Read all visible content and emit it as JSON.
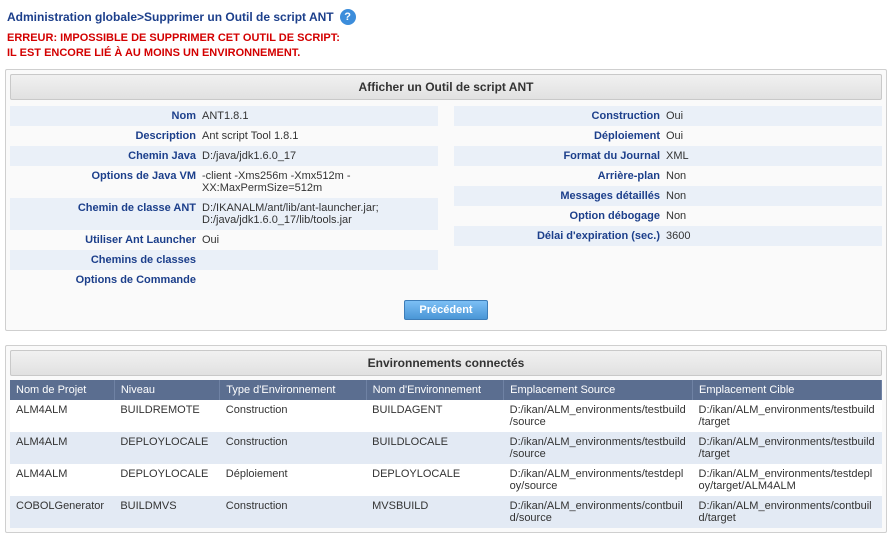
{
  "breadcrumb": {
    "root": "Administration globale",
    "sep": ">",
    "page": "Supprimer un Outil de script ANT"
  },
  "error": {
    "line1": "ERREUR: IMPOSSIBLE DE SUPPRIMER CET OUTIL DE SCRIPT:",
    "line2": "IL EST ENCORE LIÉ À AU MOINS UN ENVIRONNEMENT."
  },
  "panel1": {
    "title": "Afficher un Outil de script ANT",
    "left": [
      {
        "label": "Nom",
        "value": "ANT1.8.1"
      },
      {
        "label": "Description",
        "value": "Ant script Tool 1.8.1"
      },
      {
        "label": "Chemin Java",
        "value": "D:/java/jdk1.6.0_17"
      },
      {
        "label": "Options de Java VM",
        "value": "-client -Xms256m -Xmx512m -XX:MaxPermSize=512m"
      },
      {
        "label": "Chemin de classe ANT",
        "value": "D:/IKANALM/ant/lib/ant-launcher.jar;\nD:/java/jdk1.6.0_17/lib/tools.jar"
      },
      {
        "label": "Utiliser Ant Launcher",
        "value": "Oui"
      },
      {
        "label": "Chemins de classes",
        "value": ""
      },
      {
        "label": "Options de Commande",
        "value": ""
      }
    ],
    "right": [
      {
        "label": "Construction",
        "value": "Oui"
      },
      {
        "label": "Déploiement",
        "value": "Oui"
      },
      {
        "label": "Format du Journal",
        "value": "XML"
      },
      {
        "label": "Arrière-plan",
        "value": "Non"
      },
      {
        "label": "Messages détaillés",
        "value": "Non"
      },
      {
        "label": "Option débogage",
        "value": "Non"
      },
      {
        "label": "Délai d'expiration (sec.)",
        "value": "3600"
      }
    ],
    "back_btn": "Précédent"
  },
  "panel2": {
    "title": "Environnements connectés",
    "columns": [
      "Nom de Projet",
      "Niveau",
      "Type d'Environnement",
      "Nom d'Environnement",
      "Emplacement Source",
      "Emplacement Cible"
    ],
    "rows": [
      {
        "proj": "ALM4ALM",
        "niv": "BUILDREMOTE",
        "type": "Construction",
        "env": "BUILDAGENT",
        "src": "D:/ikan/ALM_environments/testbuild/source",
        "tgt": "D:/ikan/ALM_environments/testbuild/target"
      },
      {
        "proj": "ALM4ALM",
        "niv": "DEPLOYLOCALE",
        "type": "Construction",
        "env": "BUILDLOCALE",
        "src": "D:/ikan/ALM_environments/testbuild/source",
        "tgt": "D:/ikan/ALM_environments/testbuild/target"
      },
      {
        "proj": "ALM4ALM",
        "niv": "DEPLOYLOCALE",
        "type": "Déploiement",
        "env": "DEPLOYLOCALE",
        "src": "D:/ikan/ALM_environments/testdeploy/source",
        "tgt": "D:/ikan/ALM_environments/testdeploy/target/ALM4ALM"
      },
      {
        "proj": "COBOLGenerator",
        "niv": "BUILDMVS",
        "type": "Construction",
        "env": "MVSBUILD",
        "src": "D:/ikan/ALM_environments/contbuild/source",
        "tgt": "D:/ikan/ALM_environments/contbuild/target"
      }
    ]
  }
}
